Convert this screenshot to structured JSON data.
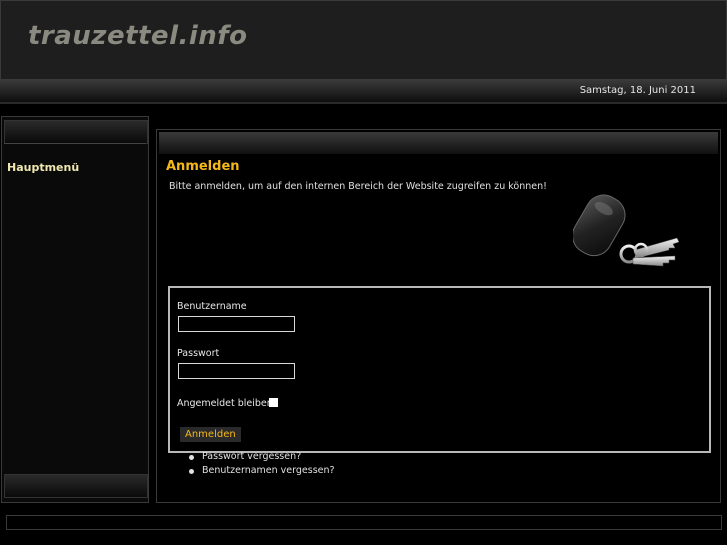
{
  "header": {
    "logo_text": "trauzettel.info"
  },
  "datebar": {
    "date": "Samstag, 18. Juni 2011"
  },
  "sidebar": {
    "menu_title": "Hauptmenü"
  },
  "main": {
    "title": "Anmelden",
    "intro": "Bitte anmelden, um auf den internen Bereich der Website zugreifen zu können!",
    "form": {
      "username_label": "Benutzername",
      "username_value": "",
      "password_label": "Passwort",
      "password_value": "",
      "remember_label": "Angemeldet bleiben",
      "remember_checked": false,
      "submit_label": "Anmelden"
    },
    "links": [
      "Passwort vergessen?",
      "Benutzernamen vergessen?"
    ]
  },
  "colors": {
    "accent": "#f5b81a",
    "menu_title": "#f0e8b0",
    "logo": "#8a8a80"
  },
  "icons": {
    "keys_image": "keys-icon"
  }
}
